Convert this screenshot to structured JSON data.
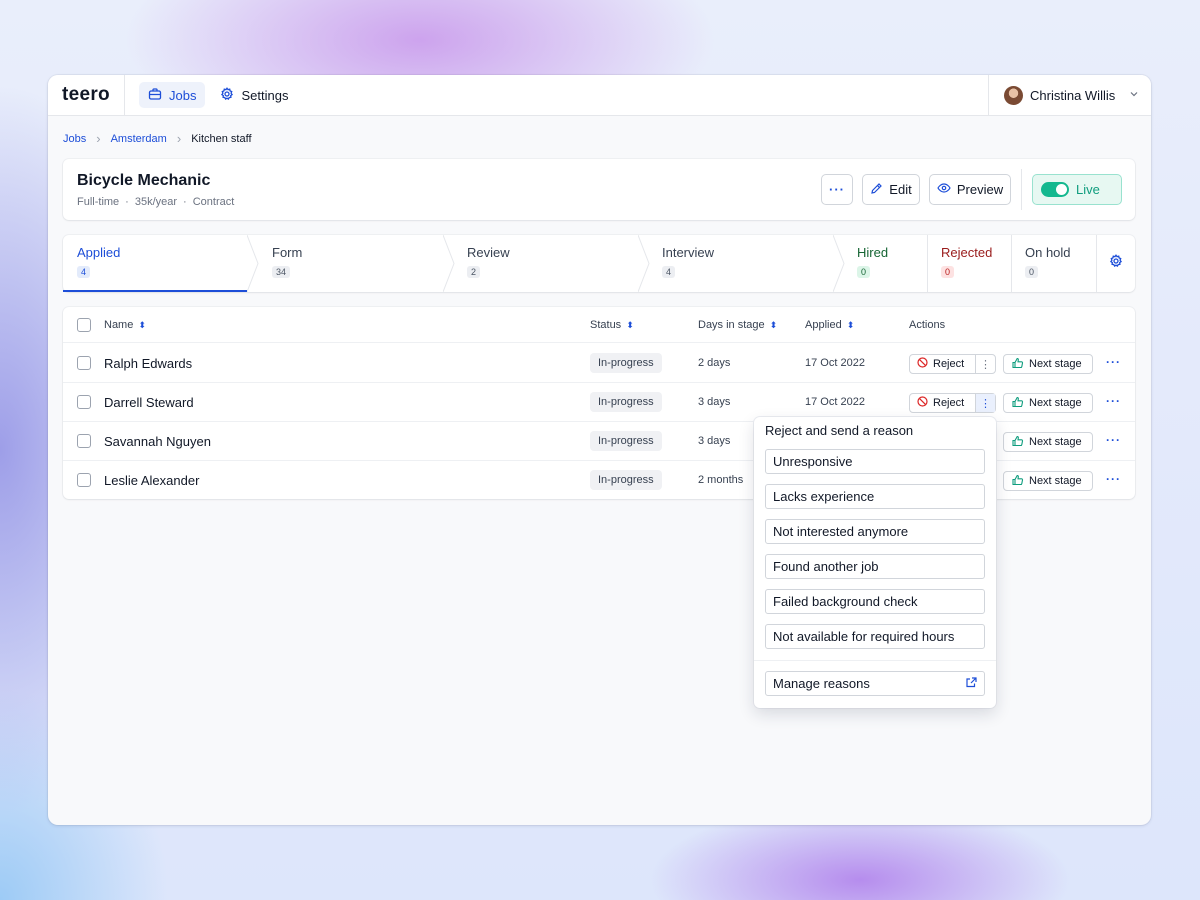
{
  "app": {
    "logo": "teero"
  },
  "nav": {
    "jobs": "Jobs",
    "settings": "Settings"
  },
  "user": {
    "name": "Christina Willis"
  },
  "breadcrumb": [
    "Jobs",
    "Amsterdam",
    "Kitchen staff"
  ],
  "job": {
    "title": "Bicycle Mechanic",
    "meta": [
      "Full-time",
      "35k/year",
      "Contract"
    ],
    "more_label": "···",
    "edit_label": "Edit",
    "preview_label": "Preview",
    "live_label": "Live"
  },
  "stages": [
    {
      "label": "Applied",
      "count": "4"
    },
    {
      "label": "Form",
      "count": "34"
    },
    {
      "label": "Review",
      "count": "2"
    },
    {
      "label": "Interview",
      "count": "4"
    },
    {
      "label": "Hired",
      "count": "0"
    },
    {
      "label": "Rejected",
      "count": "0"
    },
    {
      "label": "On hold",
      "count": "0"
    }
  ],
  "table": {
    "headers": {
      "name": "Name",
      "status": "Status",
      "days": "Days in stage",
      "applied": "Applied",
      "actions": "Actions"
    },
    "reject_label": "Reject",
    "next_label": "Next stage",
    "rows": [
      {
        "name": "Ralph Edwards",
        "status": "In-progress",
        "days": "2 days",
        "applied": "17 Oct 2022"
      },
      {
        "name": "Darrell Steward",
        "status": "In-progress",
        "days": "3 days",
        "applied": "17 Oct 2022"
      },
      {
        "name": "Savannah Nguyen",
        "status": "In-progress",
        "days": "3 days",
        "applied": ""
      },
      {
        "name": "Leslie Alexander",
        "status": "In-progress",
        "days": "2 months",
        "applied": ""
      }
    ]
  },
  "reject_menu": {
    "title": "Reject and send a reason",
    "options": [
      "Unresponsive",
      "Lacks experience",
      "Not interested anymore",
      "Found another job",
      "Failed background check",
      "Not available for required hours"
    ],
    "manage": "Manage reasons"
  },
  "colors": {
    "accent": "#1d4ed8",
    "live": "#14b88f",
    "hired": "#166534",
    "rejected": "#991b1b"
  }
}
